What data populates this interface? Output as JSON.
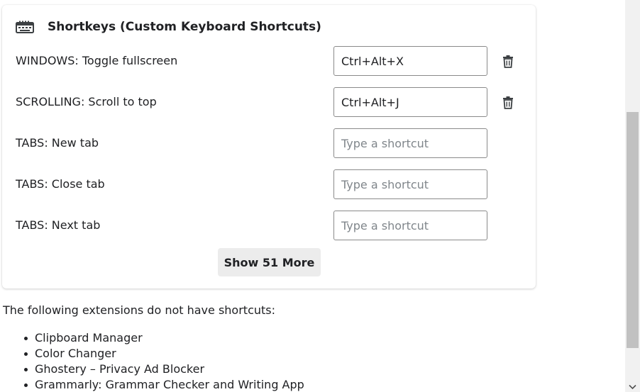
{
  "card": {
    "title": "Shortkeys (Custom Keyboard Shortcuts)",
    "icon": "keyboard-icon",
    "shortcuts": [
      {
        "label": "WINDOWS: Toggle fullscreen",
        "value": "Ctrl+Alt+X",
        "placeholder": "Type a shortcut",
        "has_delete": true
      },
      {
        "label": "SCROLLING: Scroll to top",
        "value": "Ctrl+Alt+J",
        "placeholder": "Type a shortcut",
        "has_delete": true
      },
      {
        "label": "TABS: New tab",
        "value": "",
        "placeholder": "Type a shortcut",
        "has_delete": false
      },
      {
        "label": "TABS: Close tab",
        "value": "",
        "placeholder": "Type a shortcut",
        "has_delete": false
      },
      {
        "label": "TABS: Next tab",
        "value": "",
        "placeholder": "Type a shortcut",
        "has_delete": false
      }
    ],
    "show_more_label": "Show 51 More"
  },
  "no_shortcuts": {
    "heading": "The following extensions do not have shortcuts:",
    "extensions": [
      "Clipboard Manager",
      "Color Changer",
      "Ghostery – Privacy Ad Blocker",
      "Grammarly: Grammar Checker and Writing App"
    ]
  },
  "colors": {
    "text": "#202124",
    "placeholder": "#80868b",
    "input_border": "#8a8a8a",
    "button_bg": "#ececec",
    "scroll_thumb": "#c1c1c1",
    "scroll_track": "#f1f1f1"
  }
}
